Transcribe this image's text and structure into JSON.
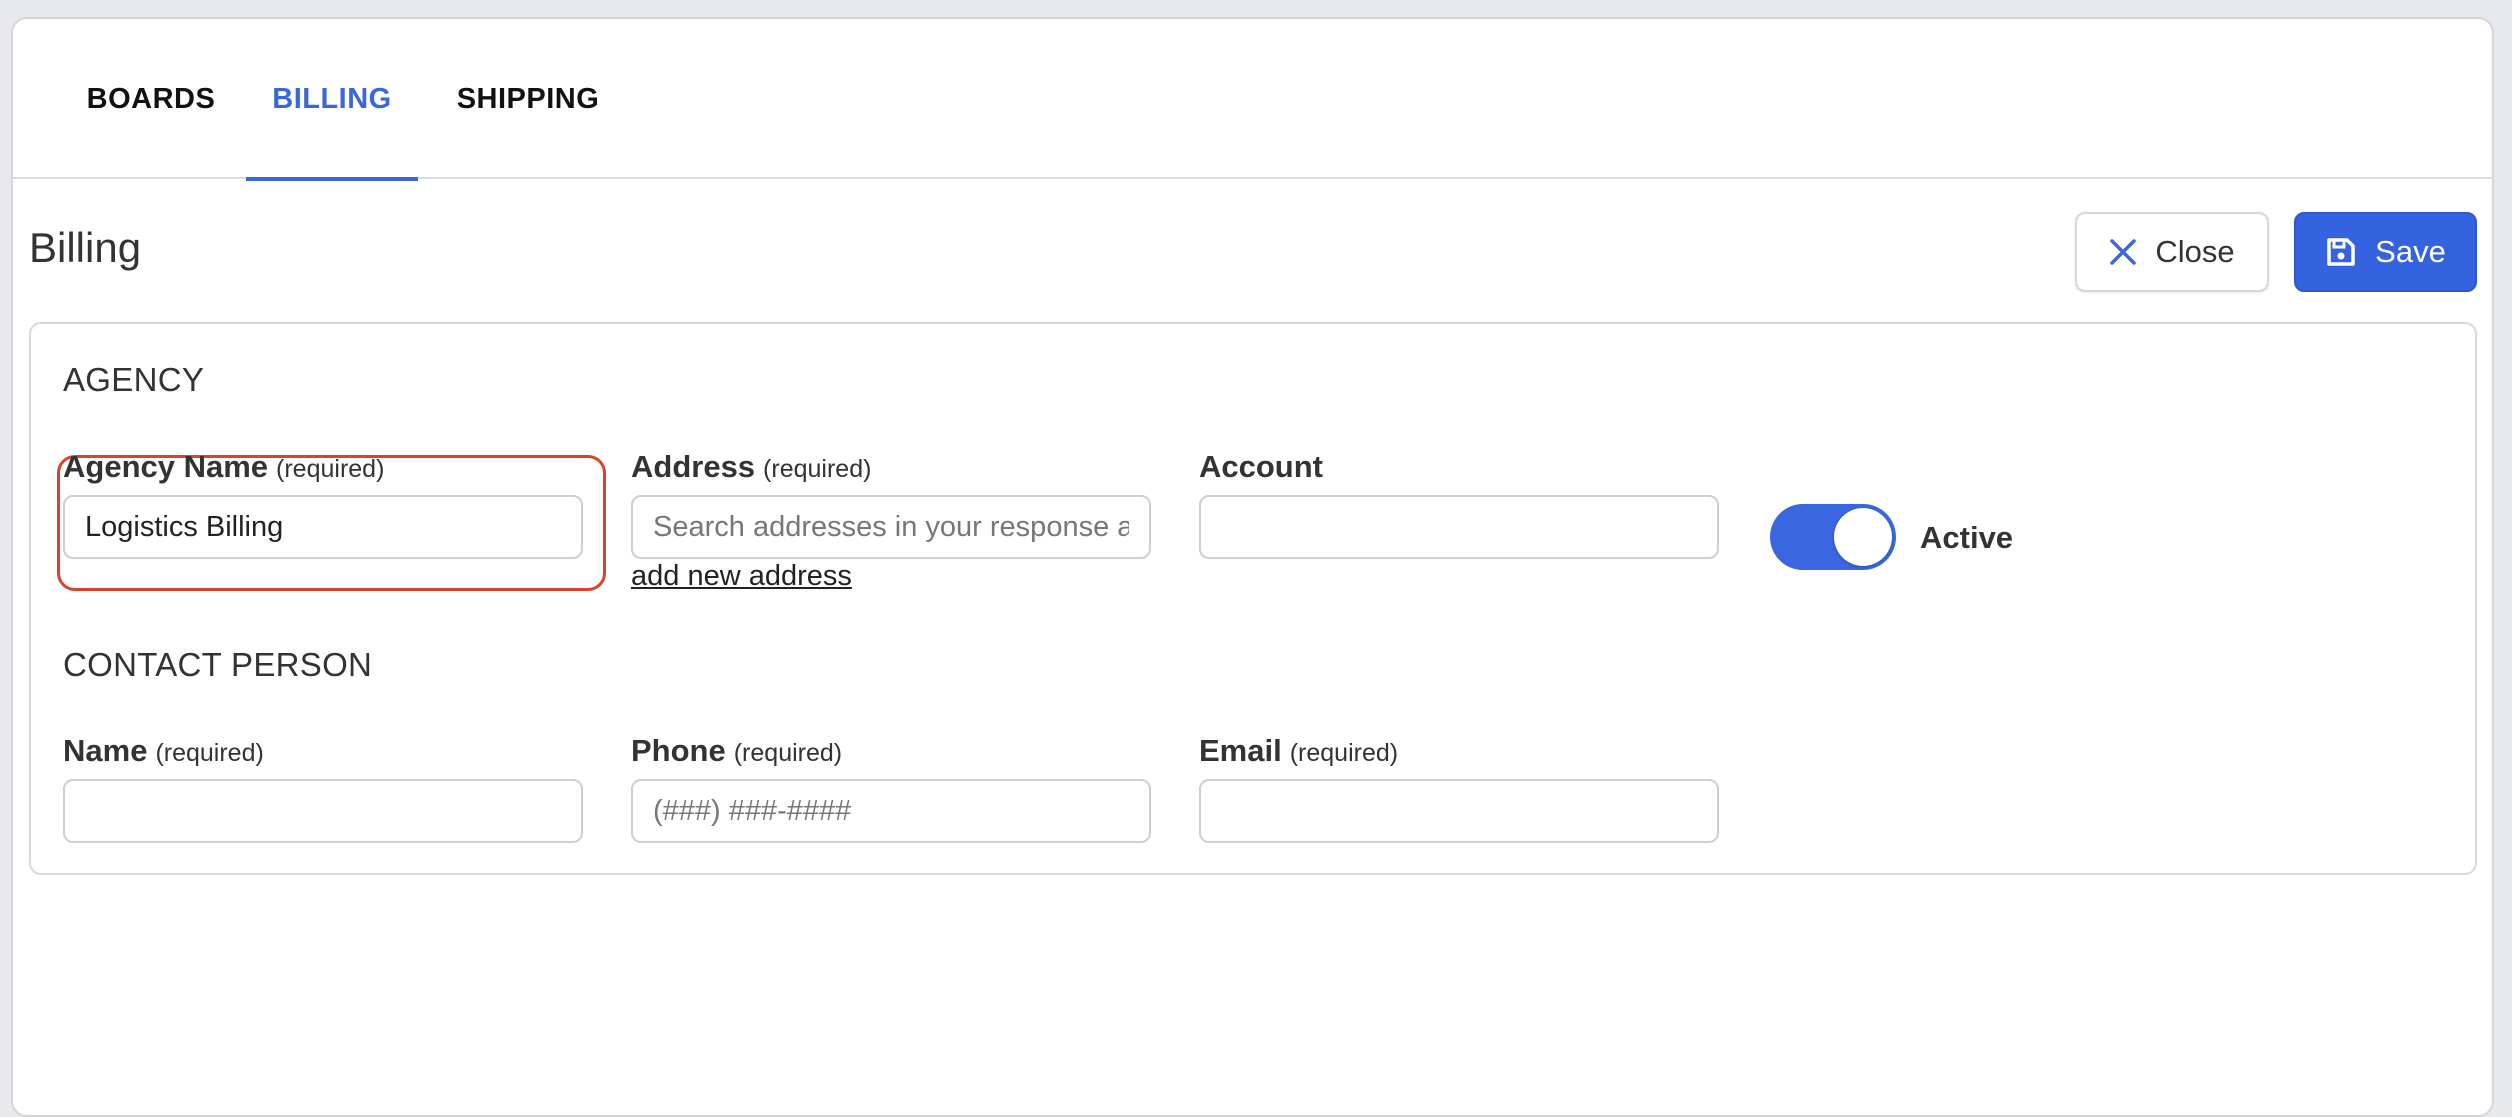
{
  "tabs": [
    {
      "label": "BOARDS",
      "active": false
    },
    {
      "label": "BILLING",
      "active": true
    },
    {
      "label": "SHIPPING",
      "active": false
    }
  ],
  "page": {
    "title": "Billing"
  },
  "actions": {
    "close_label": "Close",
    "save_label": "Save"
  },
  "agency": {
    "section_title": "AGENCY",
    "name": {
      "label": "Agency Name",
      "required": "(required)",
      "value": "Logistics Billing"
    },
    "address": {
      "label": "Address",
      "required": "(required)",
      "placeholder": "Search addresses in your response area",
      "add_link": "add new address"
    },
    "account": {
      "label": "Account",
      "value": ""
    },
    "active": {
      "label": "Active",
      "on": true
    }
  },
  "contact": {
    "section_title": "CONTACT PERSON",
    "name": {
      "label": "Name",
      "required": "(required)",
      "value": ""
    },
    "phone": {
      "label": "Phone",
      "required": "(required)",
      "placeholder": "(###) ###-####"
    },
    "email": {
      "label": "Email",
      "required": "(required)",
      "value": ""
    }
  },
  "colors": {
    "accent": "#3a67d9",
    "save_button": "#3563e0",
    "highlight": "#d9432c"
  },
  "icons": {
    "close": "close-icon",
    "save": "floppy-disk-icon"
  }
}
